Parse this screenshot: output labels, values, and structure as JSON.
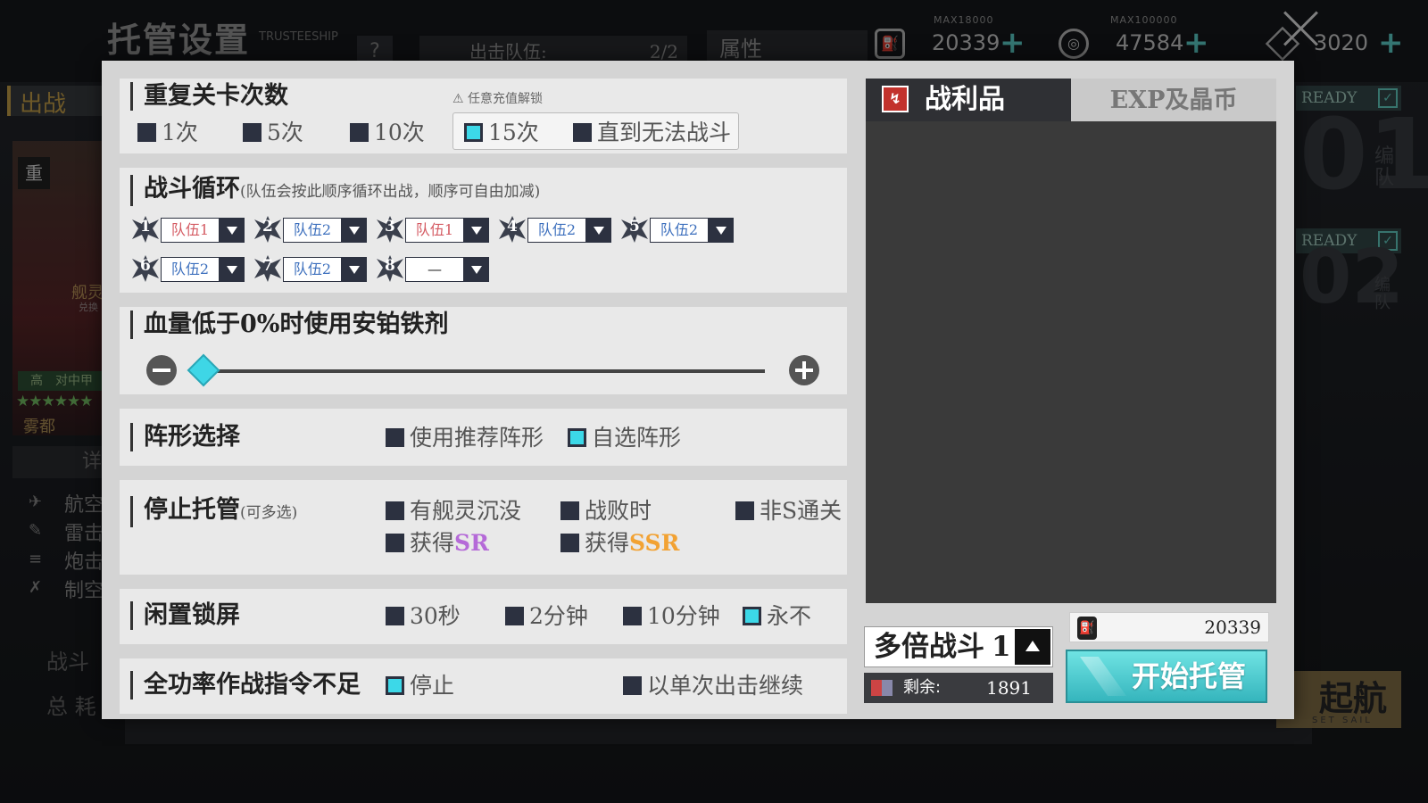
{
  "background": {
    "title": "托管设置",
    "title_en": "TRUSTEESHIP",
    "help": "?",
    "team_label": "出击队伍:",
    "team_count": "2/2",
    "attr_label": "属性",
    "resources": [
      {
        "max": "MAX18000",
        "value": "20339",
        "icon": "oil-icon"
      },
      {
        "max": "MAX100000",
        "value": "47584",
        "icon": "coin-icon"
      },
      {
        "max": "",
        "value": "3020",
        "icon": "gem-icon"
      }
    ],
    "sortie": "出战",
    "card_tag": "重",
    "card_name": "舰灵",
    "card_sub": "兑换",
    "card_grade": "高　对中甲",
    "card_stars": "★★★★★★",
    "card_city": "雾都",
    "detail": "详",
    "stats": [
      "航空",
      "雷击",
      "炮击",
      "制空"
    ],
    "bottom1": "战斗",
    "bottom2": "总 耗",
    "ready1": "READY",
    "ready2": "READY",
    "fleet1_num": "01",
    "fleet1_label": "编队",
    "fleet2_num": "02",
    "fleet2_label": "编队",
    "setsail": "起航",
    "setsail_en": "SET SAIL"
  },
  "repeat": {
    "title": "重复关卡次数",
    "lock_note": "任意充值解锁",
    "options": [
      "1次",
      "5次",
      "10次",
      "15次",
      "直到无法战斗"
    ],
    "selected": "15次"
  },
  "cycle": {
    "title": "战斗循环",
    "note": "(队伍会按此顺序循环出战，顺序可自由加减)",
    "slots": [
      {
        "num": "1",
        "team": "队伍1"
      },
      {
        "num": "2",
        "team": "队伍2"
      },
      {
        "num": "3",
        "team": "队伍1"
      },
      {
        "num": "4",
        "team": "队伍2"
      },
      {
        "num": "5",
        "team": "队伍2"
      },
      {
        "num": "6",
        "team": "队伍2"
      },
      {
        "num": "7",
        "team": "队伍2"
      },
      {
        "num": "8",
        "team": "—"
      }
    ]
  },
  "repair": {
    "title": "血量低于0%时使用安铂铁剂",
    "threshold_percent": 0
  },
  "formation": {
    "title": "阵形选择",
    "options": [
      "使用推荐阵形",
      "自选阵形"
    ],
    "selected": "自选阵形"
  },
  "stop": {
    "title": "停止托管",
    "note": "(可多选)",
    "options": [
      "有舰灵沉没",
      "战败时",
      "非S通关"
    ],
    "sr_prefix": "获得",
    "sr": "SR",
    "ssr_prefix": "获得",
    "ssr": "SSR"
  },
  "idle": {
    "title": "闲置锁屏",
    "options": [
      "30秒",
      "2分钟",
      "10分钟",
      "永不"
    ],
    "selected": "永不"
  },
  "command": {
    "title": "全功率作战指令不足",
    "options": [
      "停止",
      "以单次出击继续"
    ],
    "selected": "停止"
  },
  "right": {
    "tab_loot": "战利品",
    "tab_exp": "EXP及晶币",
    "multi_label": "多倍战斗",
    "multi_value": "1",
    "remain_label": "剩余:",
    "remain_value": "1891",
    "oil_value": "20339",
    "start": "开始托管"
  }
}
